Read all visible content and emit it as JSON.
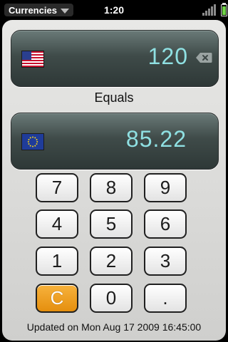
{
  "status_bar": {
    "app_name": "Currencies",
    "time": "1:20"
  },
  "converter": {
    "from": {
      "flag": "us-flag",
      "amount": "120"
    },
    "equals_label": "Equals",
    "to": {
      "flag": "eu-flag",
      "amount": "85.22"
    }
  },
  "keypad": {
    "keys": [
      "7",
      "8",
      "9",
      "4",
      "5",
      "6",
      "1",
      "2",
      "3",
      "C",
      "0",
      "."
    ]
  },
  "footer": {
    "updated": "Updated on Mon Aug 17 2009 16:45:00"
  },
  "colors": {
    "amount": "#8fe0e2",
    "clear_key": "#f0a020",
    "battery": "#6fd247"
  }
}
